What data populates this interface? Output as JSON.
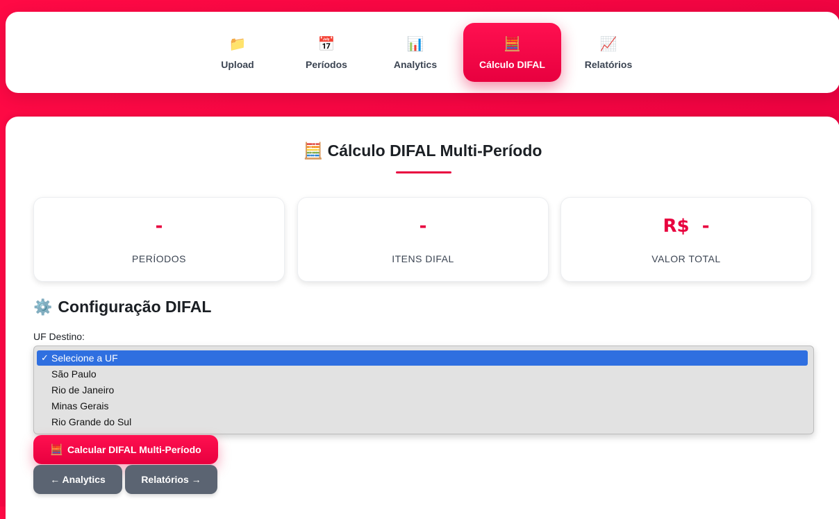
{
  "nav": {
    "tabs": [
      {
        "icon": "📁",
        "label": "Upload",
        "icon_name": "folder-icon"
      },
      {
        "icon": "📅",
        "label": "Períodos",
        "icon_name": "calendar-icon"
      },
      {
        "icon": "📊",
        "label": "Analytics",
        "icon_name": "bar-chart-icon"
      },
      {
        "icon": "🧮",
        "label": "Cálculo DIFAL",
        "icon_name": "abacus-icon"
      },
      {
        "icon": "📈",
        "label": "Relatórios",
        "icon_name": "trend-chart-icon"
      }
    ],
    "active_tab": "Cálculo DIFAL"
  },
  "main": {
    "title_icon": "🧮",
    "title": "Cálculo DIFAL Multi-Período",
    "stats": [
      {
        "value": "-",
        "caption": "PERÍODOS"
      },
      {
        "value": "-",
        "caption": "ITENS DIFAL"
      },
      {
        "value": "R$  -",
        "caption": "VALOR TOTAL"
      }
    ],
    "config": {
      "icon": "⚙️",
      "title": "Configuração DIFAL",
      "uf_label": "UF Destino:",
      "uf_options": [
        "Selecione a UF",
        "São Paulo",
        "Rio de Janeiro",
        "Minas Gerais",
        "Rio Grande do Sul"
      ],
      "uf_selected": "Selecione a UF",
      "check_mark": "✓"
    },
    "buttons": {
      "calculate_icon": "🧮",
      "calculate": "Calcular DIFAL Multi-Período",
      "back": "← Analytics",
      "next": "Relatórios →"
    }
  },
  "colors": {
    "accent": "#e8003f",
    "background": "#ff0a45",
    "selected_option": "#2f6fe0",
    "secondary_button": "#5b6472"
  }
}
